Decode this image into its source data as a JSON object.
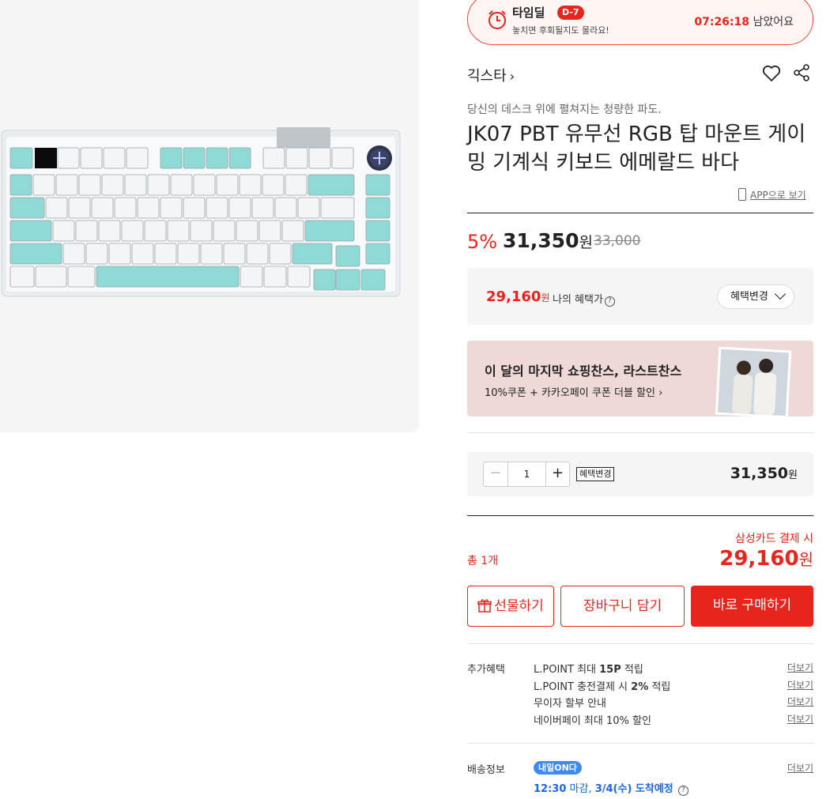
{
  "timedeal": {
    "title": "타임딜",
    "dday": "D-7",
    "sub": "놓치면 후회될지도 몰라요!",
    "time": "07:26:18",
    "time_suffix": " 남았어요"
  },
  "product": {
    "brand": "긱스타",
    "subtitle": "당신의 데스크 위에 펼쳐지는 청량한 파도.",
    "name": "JK07 PBT 유무선 RGB 탑 마운트 게이밍 기계식 키보드 에메랄드 바다",
    "app_view": "APP으로 보기"
  },
  "price": {
    "discount": "5%",
    "sale": "31,350",
    "won": "원",
    "original": "33,000"
  },
  "benefit": {
    "amount": "29,160",
    "won": "원",
    "label": "나의 혜택가",
    "change_label": "혜택변경"
  },
  "banner": {
    "title": "이 달의 마지막 쇼핑찬스, 라스트찬스",
    "sub": "10%쿠폰 + 카카오페이 쿠폰 더블 할인"
  },
  "quantity": {
    "value": "1",
    "benefit_change": "혜택변경",
    "price": "31,350",
    "won": "원"
  },
  "total": {
    "label": "총 1개",
    "card_label": "삼성카드 결제 시",
    "price": "29,160",
    "won": "원"
  },
  "actions": {
    "gift": "선물하기",
    "cart": "장바구니 담기",
    "buy": "바로 구매하기"
  },
  "extra": {
    "title": "추가혜택",
    "more": "더보기",
    "items": [
      {
        "pre": "L.POINT 최대 ",
        "bold": "15P",
        "post": " 적립"
      },
      {
        "pre": "L.POINT 충전결제 시 ",
        "bold": "2%",
        "post": " 적립"
      },
      {
        "pre": "무이자 할부 안내",
        "bold": "",
        "post": ""
      },
      {
        "pre": "네이버페이 최대 10% 할인",
        "bold": "",
        "post": ""
      }
    ]
  },
  "shipping": {
    "title": "배송정보",
    "badge": "내일ON다",
    "more": "더보기",
    "time": "12:30",
    "cutoff": " 마감, ",
    "arrival": "3/4(수) 도착예정"
  },
  "colors": {
    "accent": "#e8251d",
    "keycap_mint": "#8fd9d6",
    "keycap_white": "#f3f5f6",
    "link_blue": "#1d66e5"
  }
}
